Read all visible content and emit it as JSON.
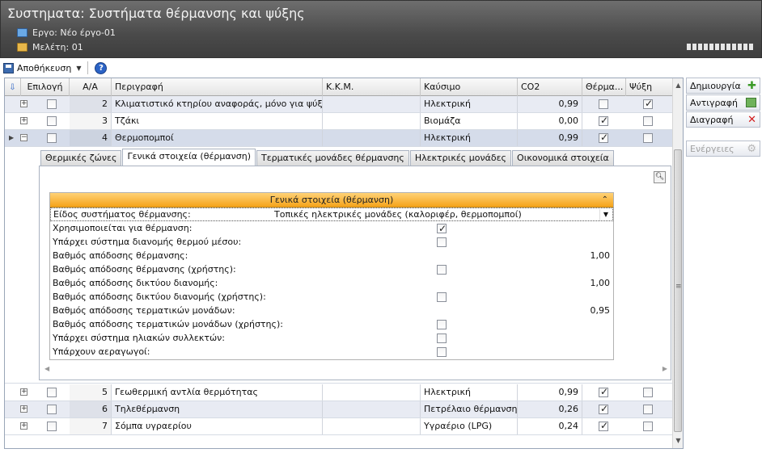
{
  "window": {
    "title": "Συστηματα: Συστήματα θέρμανσης και ψύξης",
    "project_label": "Εργο: Νέο έργο-01",
    "study_label": "Μελέτη: 01"
  },
  "toolbar": {
    "save_label": "Αποθήκευση",
    "help_glyph": "?"
  },
  "grid": {
    "columns": {
      "epilogi": "Επιλογή",
      "aa": "Α/Α",
      "perigrafi": "Περιγραφή",
      "kkm": "Κ.Κ.Μ.",
      "kafsimo": "Καύσιμο",
      "co2": "CO2",
      "thermansi": "Θέρμα...",
      "psyxi": "Ψύξη"
    },
    "rows": [
      {
        "aa": "2",
        "desc": "Κλιματιστικό κτηρίου αναφοράς, μόνο για ψύξη",
        "kkm": "",
        "fuel": "Ηλεκτρική",
        "co2": "0,99",
        "heat": false,
        "cool": true,
        "selected": false,
        "expanded": false
      },
      {
        "aa": "3",
        "desc": "Τζάκι",
        "kkm": "",
        "fuel": "Βιομάζα",
        "co2": "0,00",
        "heat": true,
        "cool": false,
        "selected": false,
        "expanded": false
      },
      {
        "aa": "4",
        "desc": "Θερμοπομποί",
        "kkm": "",
        "fuel": "Ηλεκτρική",
        "co2": "0,99",
        "heat": true,
        "cool": false,
        "selected": false,
        "expanded": true
      },
      {
        "aa": "5",
        "desc": "Γεωθερμική αντλία θερμότητας",
        "kkm": "",
        "fuel": "Ηλεκτρική",
        "co2": "0,99",
        "heat": true,
        "cool": false,
        "selected": false,
        "expanded": false
      },
      {
        "aa": "6",
        "desc": "Τηλεθέρμανση",
        "kkm": "",
        "fuel": "Πετρέλαιο θέρμανσης",
        "co2": "0,26",
        "heat": true,
        "cool": false,
        "selected": false,
        "expanded": false
      },
      {
        "aa": "7",
        "desc": "Σόμπα υγραερίου",
        "kkm": "",
        "fuel": "Υγραέριο (LPG)",
        "co2": "0,24",
        "heat": true,
        "cool": false,
        "selected": false,
        "expanded": false
      }
    ]
  },
  "detail": {
    "tabs": [
      "Θερμικές ζώνες",
      "Γενικά στοιχεία (θέρμανση)",
      "Τερματικές μονάδες θέρμανσης",
      "Ηλεκτρικές μονάδες",
      "Οικονομικά στοιχεία"
    ],
    "active_tab": 1,
    "panel_title": "Γενικά στοιχεία (θέρμανση)",
    "system_type_label": "Είδος συστήματος θέρμανσης:",
    "system_type_value": "Τοπικές ηλεκτρικές μονάδες (καλοριφέρ, θερμοπομποί)",
    "properties": [
      {
        "label": "Χρησιμοποιείται για θέρμανση:",
        "kind": "check",
        "checked": true
      },
      {
        "label": "Υπάρχει σύστημα διανομής θερμού μέσου:",
        "kind": "check",
        "checked": false
      },
      {
        "label": "Βαθμός απόδοσης θέρμανσης:",
        "kind": "value",
        "value": "1,00"
      },
      {
        "label": "Βαθμός απόδοσης θέρμανσης (χρήστης):",
        "kind": "check",
        "checked": false
      },
      {
        "label": "Βαθμός απόδοσης δικτύου διανομής:",
        "kind": "value",
        "value": "1,00"
      },
      {
        "label": "Βαθμός απόδοσης δικτύου διανομής (χρήστης):",
        "kind": "check",
        "checked": false
      },
      {
        "label": "Βαθμός απόδοσης τερματικών μονάδων:",
        "kind": "value",
        "value": "0,95"
      },
      {
        "label": "Βαθμός απόδοσης τερματικών μονάδων (χρήστης):",
        "kind": "check",
        "checked": false
      },
      {
        "label": "Υπάρχει σύστημα ηλιακών συλλεκτών:",
        "kind": "check",
        "checked": false
      },
      {
        "label": "Υπάρχουν αεραγωγοί:",
        "kind": "check",
        "checked": false
      }
    ]
  },
  "side_buttons": {
    "create": "Δημιουργία",
    "copy": "Αντιγραφή",
    "delete": "Διαγραφή",
    "actions": "Ενέργειες"
  }
}
